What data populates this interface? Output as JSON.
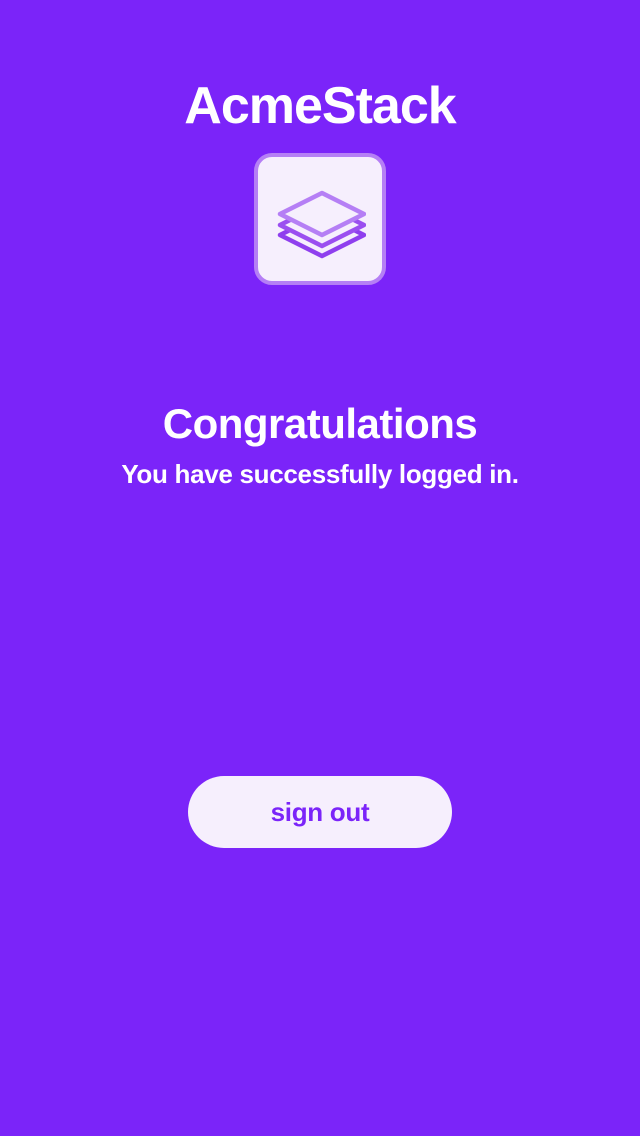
{
  "app": {
    "title": "AcmeStack",
    "logo_icon": "layers-icon"
  },
  "main": {
    "headline": "Congratulations",
    "message": "You have successfully logged in."
  },
  "actions": {
    "sign_out_label": "sign out"
  },
  "colors": {
    "background": "#7b24f9",
    "button_background": "#f6effd",
    "button_text": "#7b24f9",
    "logo_border": "#b57ff5",
    "logo_stroke": "#9b4ff0"
  }
}
